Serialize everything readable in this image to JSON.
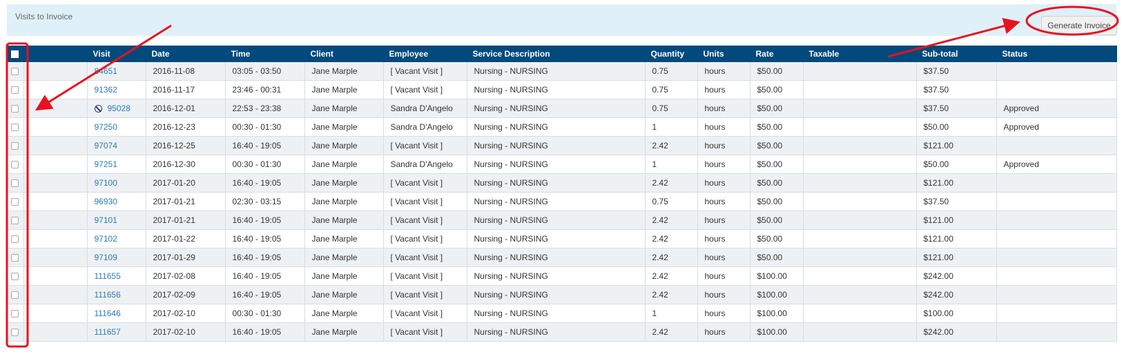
{
  "panel": {
    "title": "Visits to Invoice"
  },
  "toolbar": {
    "generate_label": "Generate Invoice"
  },
  "table": {
    "columns": [
      "",
      "Visit",
      "Date",
      "Time",
      "Client",
      "Employee",
      "Service Description",
      "Quantity",
      "Units",
      "Rate",
      "Taxable",
      "Sub-total",
      "Status"
    ],
    "rows": [
      {
        "visit": "84651",
        "date": "2016-11-08",
        "time": "03:05 - 03:50",
        "client": "Jane Marple",
        "employee": "[ Vacant Visit ]",
        "service": "Nursing - NURSING",
        "quantity": "0.75",
        "units": "hours",
        "rate": "$50.00",
        "taxable": "",
        "subtotal": "$37.50",
        "status": "",
        "icon": ""
      },
      {
        "visit": "91362",
        "date": "2016-11-17",
        "time": "23:46 - 00:31",
        "client": "Jane Marple",
        "employee": "[ Vacant Visit ]",
        "service": "Nursing - NURSING",
        "quantity": "0.75",
        "units": "hours",
        "rate": "$50.00",
        "taxable": "",
        "subtotal": "$37.50",
        "status": "",
        "icon": ""
      },
      {
        "visit": "95028",
        "date": "2016-12-01",
        "time": "22:53 - 23:38",
        "client": "Jane Marple",
        "employee": "Sandra D'Angelo",
        "service": "Nursing - NURSING",
        "quantity": "0.75",
        "units": "hours",
        "rate": "$50.00",
        "taxable": "",
        "subtotal": "$37.50",
        "status": "Approved",
        "icon": "no-entry-icon"
      },
      {
        "visit": "97250",
        "date": "2016-12-23",
        "time": "00:30 - 01:30",
        "client": "Jane Marple",
        "employee": "Sandra D'Angelo",
        "service": "Nursing - NURSING",
        "quantity": "1",
        "units": "hours",
        "rate": "$50.00",
        "taxable": "",
        "subtotal": "$50.00",
        "status": "Approved",
        "icon": ""
      },
      {
        "visit": "97074",
        "date": "2016-12-25",
        "time": "16:40 - 19:05",
        "client": "Jane Marple",
        "employee": "[ Vacant Visit ]",
        "service": "Nursing - NURSING",
        "quantity": "2.42",
        "units": "hours",
        "rate": "$50.00",
        "taxable": "",
        "subtotal": "$121.00",
        "status": "",
        "icon": ""
      },
      {
        "visit": "97251",
        "date": "2016-12-30",
        "time": "00:30 - 01:30",
        "client": "Jane Marple",
        "employee": "Sandra D'Angelo",
        "service": "Nursing - NURSING",
        "quantity": "1",
        "units": "hours",
        "rate": "$50.00",
        "taxable": "",
        "subtotal": "$50.00",
        "status": "Approved",
        "icon": ""
      },
      {
        "visit": "97100",
        "date": "2017-01-20",
        "time": "16:40 - 19:05",
        "client": "Jane Marple",
        "employee": "[ Vacant Visit ]",
        "service": "Nursing - NURSING",
        "quantity": "2.42",
        "units": "hours",
        "rate": "$50.00",
        "taxable": "",
        "subtotal": "$121.00",
        "status": "",
        "icon": ""
      },
      {
        "visit": "96930",
        "date": "2017-01-21",
        "time": "02:30 - 03:15",
        "client": "Jane Marple",
        "employee": "[ Vacant Visit ]",
        "service": "Nursing - NURSING",
        "quantity": "0.75",
        "units": "hours",
        "rate": "$50.00",
        "taxable": "",
        "subtotal": "$37.50",
        "status": "",
        "icon": ""
      },
      {
        "visit": "97101",
        "date": "2017-01-21",
        "time": "16:40 - 19:05",
        "client": "Jane Marple",
        "employee": "[ Vacant Visit ]",
        "service": "Nursing - NURSING",
        "quantity": "2.42",
        "units": "hours",
        "rate": "$50.00",
        "taxable": "",
        "subtotal": "$121.00",
        "status": "",
        "icon": ""
      },
      {
        "visit": "97102",
        "date": "2017-01-22",
        "time": "16:40 - 19:05",
        "client": "Jane Marple",
        "employee": "[ Vacant Visit ]",
        "service": "Nursing - NURSING",
        "quantity": "2.42",
        "units": "hours",
        "rate": "$50.00",
        "taxable": "",
        "subtotal": "$121.00",
        "status": "",
        "icon": ""
      },
      {
        "visit": "97109",
        "date": "2017-01-29",
        "time": "16:40 - 19:05",
        "client": "Jane Marple",
        "employee": "[ Vacant Visit ]",
        "service": "Nursing - NURSING",
        "quantity": "2.42",
        "units": "hours",
        "rate": "$50.00",
        "taxable": "",
        "subtotal": "$121.00",
        "status": "",
        "icon": ""
      },
      {
        "visit": "111655",
        "date": "2017-02-08",
        "time": "16:40 - 19:05",
        "client": "Jane Marple",
        "employee": "[ Vacant Visit ]",
        "service": "Nursing - NURSING",
        "quantity": "2.42",
        "units": "hours",
        "rate": "$100.00",
        "taxable": "",
        "subtotal": "$242.00",
        "status": "",
        "icon": ""
      },
      {
        "visit": "111656",
        "date": "2017-02-09",
        "time": "16:40 - 19:05",
        "client": "Jane Marple",
        "employee": "[ Vacant Visit ]",
        "service": "Nursing - NURSING",
        "quantity": "2.42",
        "units": "hours",
        "rate": "$100.00",
        "taxable": "",
        "subtotal": "$242.00",
        "status": "",
        "icon": ""
      },
      {
        "visit": "111646",
        "date": "2017-02-10",
        "time": "00:30 - 01:30",
        "client": "Jane Marple",
        "employee": "[ Vacant Visit ]",
        "service": "Nursing - NURSING",
        "quantity": "1",
        "units": "hours",
        "rate": "$100.00",
        "taxable": "",
        "subtotal": "$100.00",
        "status": "",
        "icon": ""
      },
      {
        "visit": "111657",
        "date": "2017-02-10",
        "time": "16:40 - 19:05",
        "client": "Jane Marple",
        "employee": "[ Vacant Visit ]",
        "service": "Nursing - NURSING",
        "quantity": "2.42",
        "units": "hours",
        "rate": "$100.00",
        "taxable": "",
        "subtotal": "$242.00",
        "status": "",
        "icon": ""
      }
    ]
  },
  "colors": {
    "header_bg": "#024a7c",
    "panel_bg": "#dff0f9",
    "link": "#2a7ab8",
    "annotation": "#e8121f"
  }
}
